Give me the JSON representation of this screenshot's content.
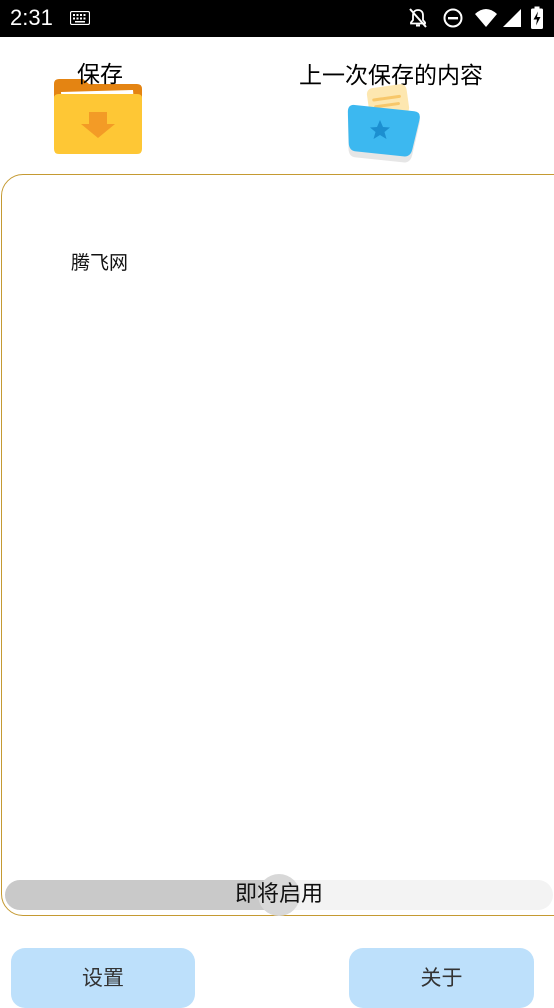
{
  "status_bar": {
    "time": "2:31",
    "icons": [
      "keyboard-icon",
      "notifications-off-icon",
      "do-not-disturb-icon",
      "wifi-icon",
      "signal-icon",
      "battery-charging-icon"
    ]
  },
  "toolbar": {
    "save_label": "保存",
    "last_saved_label": "上一次保存的内容"
  },
  "editor": {
    "content": "腾飞网"
  },
  "slider": {
    "label": "即将启用",
    "value_fraction": 0.5
  },
  "buttons": {
    "settings": "设置",
    "about": "关于"
  },
  "colors": {
    "editor_border": "#c59a32",
    "button_bg": "#bde0fb",
    "folder_body": "#fec735",
    "folder_tab": "#e48412",
    "bag_blue": "#3cb8f0"
  }
}
